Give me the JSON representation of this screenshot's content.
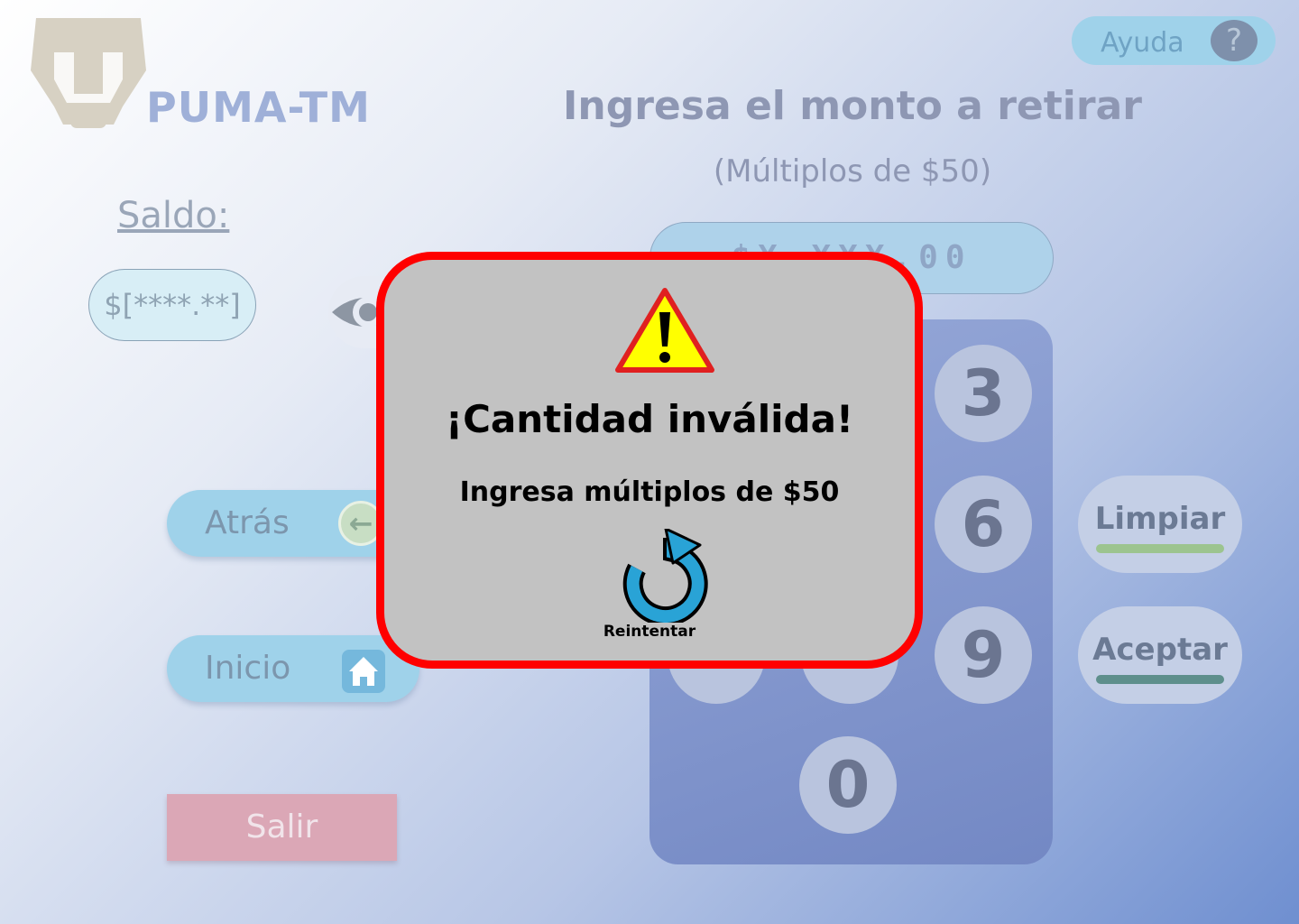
{
  "app": {
    "brand": "PUMA-TM"
  },
  "header": {
    "help_label": "Ayuda",
    "help_icon": "?"
  },
  "withdraw": {
    "title": "Ingresa el monto a retirar",
    "subtitle": "(Múltiplos de $50)",
    "amount_placeholder": "$X,XXX.00"
  },
  "balance": {
    "label": "Saldo:",
    "value": "$[****.**]"
  },
  "nav": {
    "back_label": "Atrás",
    "home_label": "Inicio",
    "exit_label": "Salir"
  },
  "keypad": {
    "visible_keys": [
      "3",
      "6",
      "9",
      "0"
    ],
    "clear_label": "Limpiar",
    "accept_label": "Aceptar"
  },
  "modal": {
    "title": "¡Cantidad inválida!",
    "message": "Ingresa múltiplos de $50",
    "retry_label": "Reintentar"
  },
  "colors": {
    "modal_border": "#ff0000",
    "modal_bg": "#c2c2c2",
    "clear_bar": "#9cc48f",
    "accept_bar": "#5e8f8c",
    "exit_bg": "#dba7b6"
  }
}
